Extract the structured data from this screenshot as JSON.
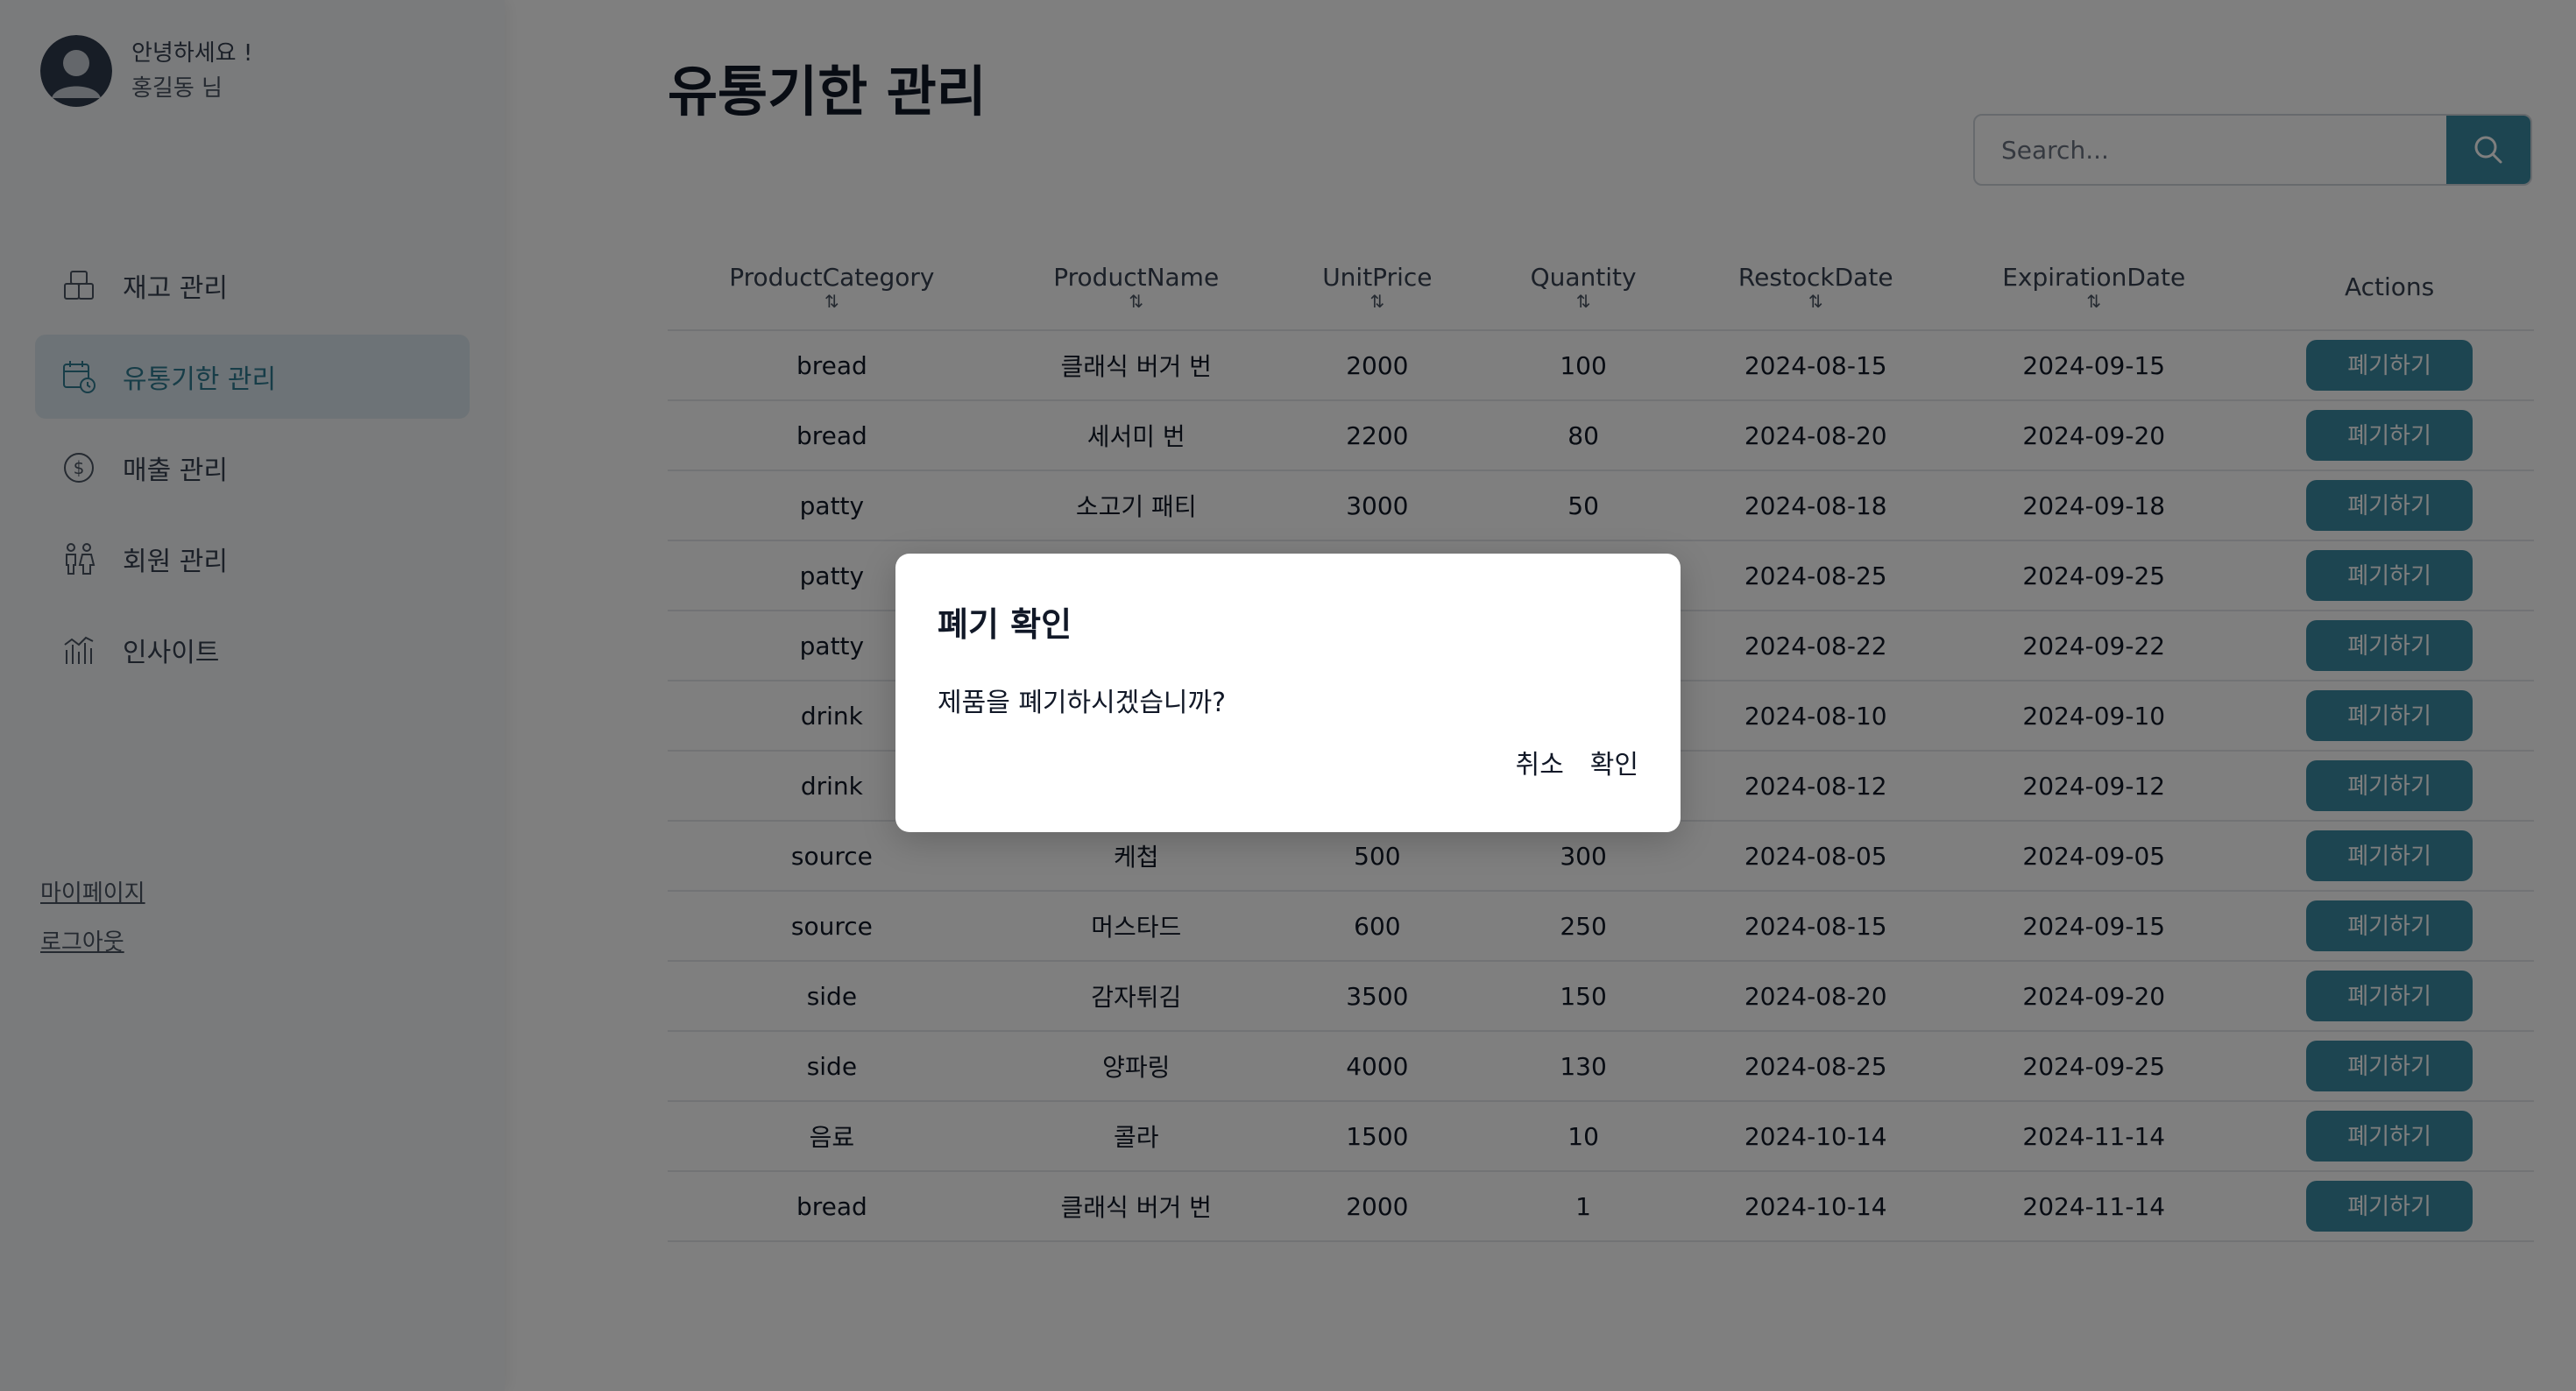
{
  "sidebar": {
    "greeting": "안녕하세요 !",
    "user_name": "홍길동 님",
    "items": [
      {
        "label": "재고 관리",
        "icon": "inventory-box-icon"
      },
      {
        "label": "유통기한 관리",
        "icon": "calendar-clock-icon",
        "active": true
      },
      {
        "label": "매출 관리",
        "icon": "dollar-circle-icon"
      },
      {
        "label": "회원 관리",
        "icon": "people-icon"
      },
      {
        "label": "인사이트",
        "icon": "chart-bars-icon"
      }
    ],
    "links": {
      "mypage": "마이페이지",
      "logout": "로그아웃"
    }
  },
  "main": {
    "title": "유통기한 관리",
    "search": {
      "placeholder": "Search...",
      "icon": "search-icon"
    },
    "table": {
      "columns": [
        "ProductCategory",
        "ProductName",
        "UnitPrice",
        "Quantity",
        "RestockDate",
        "ExpirationDate",
        "Actions"
      ],
      "sort_symbol": "⇅",
      "action_label": "폐기하기",
      "rows": [
        [
          "bread",
          "클래식 버거 번",
          "2000",
          "100",
          "2024-08-15",
          "2024-09-15"
        ],
        [
          "bread",
          "세서미 번",
          "2200",
          "80",
          "2024-08-20",
          "2024-09-20"
        ],
        [
          "patty",
          "소고기 패티",
          "3000",
          "50",
          "2024-08-18",
          "2024-09-18"
        ],
        [
          "patty",
          "",
          "",
          "",
          "2024-08-25",
          "2024-09-25"
        ],
        [
          "patty",
          "",
          "",
          "",
          "2024-08-22",
          "2024-09-22"
        ],
        [
          "drink",
          "",
          "",
          "",
          "2024-08-10",
          "2024-09-10"
        ],
        [
          "drink",
          "",
          "",
          "",
          "2024-08-12",
          "2024-09-12"
        ],
        [
          "source",
          "케첩",
          "500",
          "300",
          "2024-08-05",
          "2024-09-05"
        ],
        [
          "source",
          "머스타드",
          "600",
          "250",
          "2024-08-15",
          "2024-09-15"
        ],
        [
          "side",
          "감자튀김",
          "3500",
          "150",
          "2024-08-20",
          "2024-09-20"
        ],
        [
          "side",
          "양파링",
          "4000",
          "130",
          "2024-08-25",
          "2024-09-25"
        ],
        [
          "음료",
          "콜라",
          "1500",
          "10",
          "2024-10-14",
          "2024-11-14"
        ],
        [
          "bread",
          "클래식 버거 번",
          "2000",
          "1",
          "2024-10-14",
          "2024-11-14"
        ]
      ]
    }
  },
  "modal": {
    "title": "폐기 확인",
    "message": "제품을 폐기하시겠습니까?",
    "cancel": "취소",
    "confirm": "확인"
  },
  "colors": {
    "accent": "#3a8aa2",
    "active_bg": "#dbe7ee",
    "overlay": "rgba(0,0,0,0.5)"
  }
}
